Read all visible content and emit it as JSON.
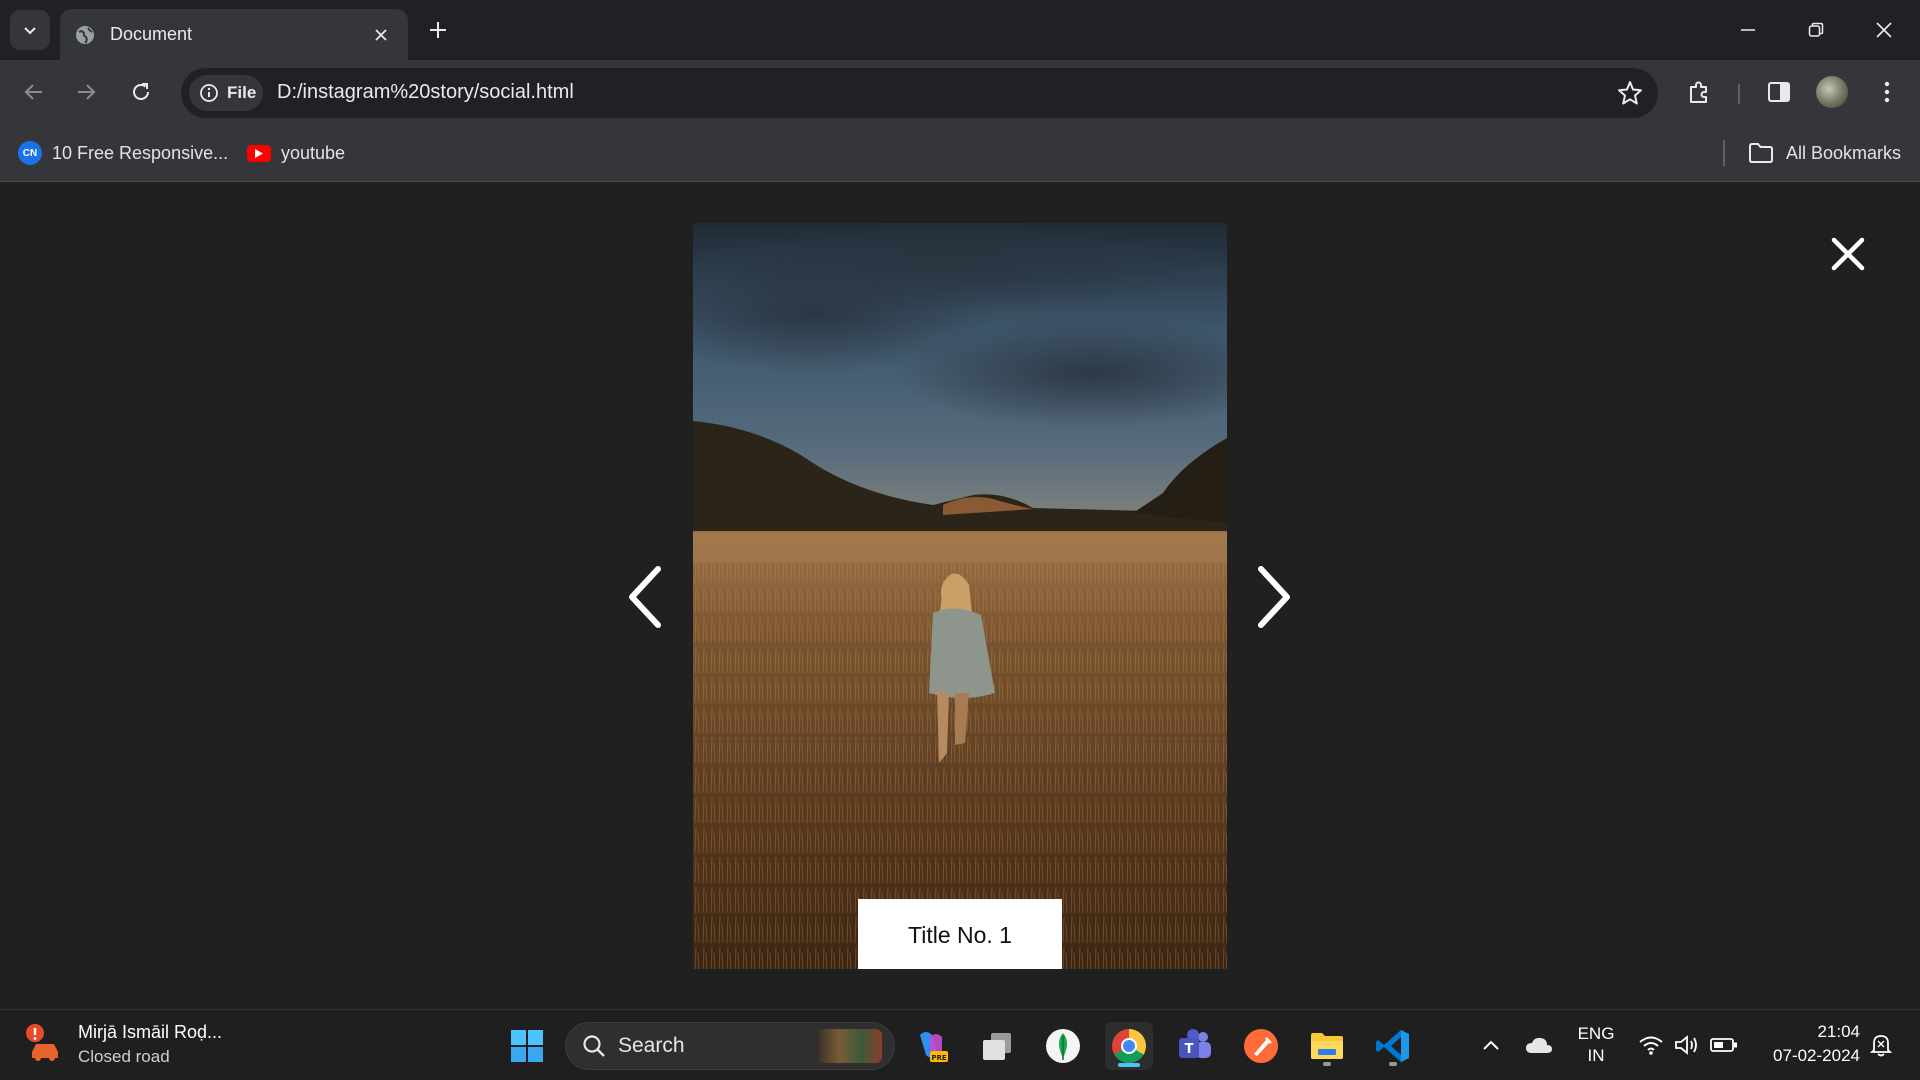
{
  "browser": {
    "tab": {
      "title": "Document"
    },
    "address_bar": {
      "scheme_label": "File",
      "url": "D:/instagram%20story/social.html"
    },
    "bookmarks": [
      {
        "label": "10 Free Responsive...",
        "icon": "cn-favicon"
      },
      {
        "label": "youtube",
        "icon": "youtube-icon"
      }
    ],
    "all_bookmarks_label": "All Bookmarks"
  },
  "story": {
    "caption": "Title No. 1",
    "photo_description_icon": "wheat-field-photo"
  },
  "taskbar": {
    "weather": {
      "title": "Mirjā Ismāil Roḍ...",
      "subtitle": "Closed road"
    },
    "search_label": "Search",
    "language": {
      "line1": "ENG",
      "line2": "IN"
    },
    "clock": {
      "time": "21:04",
      "date": "07-02-2024"
    },
    "apps": [
      "windows-start",
      "copilot",
      "task-view",
      "mongodb-compass",
      "chrome",
      "teams",
      "postman",
      "file-explorer",
      "vscode"
    ]
  },
  "colors": {
    "page_background": "#202020",
    "browser_chrome": "#35363a",
    "caption_background": "#ffffff",
    "taskbar_accent": "#4cc2ff"
  }
}
